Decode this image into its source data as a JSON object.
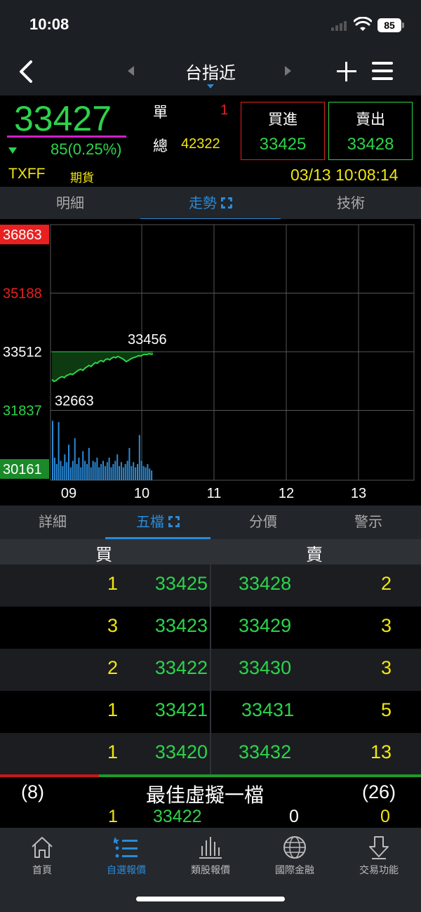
{
  "status": {
    "time": "10:08",
    "battery": "85"
  },
  "nav": {
    "title": "台指近"
  },
  "quote": {
    "price": "33427",
    "change": "85(0.25%)",
    "single_label": "單",
    "single_value": "1",
    "total_label": "總",
    "total_value": "42322",
    "buy_label": "買進",
    "buy_price": "33425",
    "sell_label": "賣出",
    "sell_price": "33428",
    "symbol": "TXFF",
    "type": "期貨",
    "datetime": "03/13 10:08:14"
  },
  "top_tabs": [
    {
      "label": "明細"
    },
    {
      "label": "走勢"
    },
    {
      "label": "技術"
    }
  ],
  "chart_data": {
    "type": "line",
    "y_labels": [
      "36863",
      "35188",
      "33512",
      "31837",
      "30161"
    ],
    "y_label_colors": [
      "#ffffff",
      "#e82020",
      "#ffffff",
      "#2bd44a",
      "#ffffff"
    ],
    "reference": 33512,
    "ylim": [
      30161,
      36863
    ],
    "x_ticks": [
      "09",
      "10",
      "11",
      "12",
      "13"
    ],
    "high_label": "33456",
    "low_label": "32663",
    "price_series": [
      32720,
      32663,
      32690,
      32740,
      32780,
      32800,
      32770,
      32830,
      32850,
      32880,
      32860,
      32900,
      32950,
      32990,
      33010,
      32980,
      33040,
      33080,
      33120,
      33090,
      33150,
      33200,
      33180,
      33240,
      33260,
      33230,
      33290,
      33310,
      33280,
      33330,
      33360,
      33340,
      33380,
      33350,
      33320,
      33280,
      33230,
      33260,
      33300,
      33330,
      33350,
      33370,
      33400,
      33390,
      33420,
      33440,
      33430,
      33456,
      33440,
      33450
    ],
    "volume_series": [
      0.92,
      0.35,
      0.25,
      0.9,
      0.3,
      0.22,
      0.4,
      0.28,
      0.55,
      0.2,
      0.3,
      0.65,
      0.25,
      0.35,
      0.2,
      0.45,
      0.3,
      0.25,
      0.5,
      0.2,
      0.3,
      0.28,
      0.35,
      0.2,
      0.25,
      0.3,
      0.22,
      0.28,
      0.35,
      0.2,
      0.25,
      0.3,
      0.4,
      0.22,
      0.28,
      0.2,
      0.25,
      0.3,
      0.5,
      0.22,
      0.28,
      0.2,
      0.25,
      0.7,
      0.3,
      0.22,
      0.2,
      0.25,
      0.18,
      0.15
    ]
  },
  "mid_tabs": [
    {
      "label": "詳細"
    },
    {
      "label": "五檔"
    },
    {
      "label": "分價"
    },
    {
      "label": "警示"
    }
  ],
  "book": {
    "buy_header": "買",
    "sell_header": "賣",
    "rows": [
      {
        "bid_qty": "1",
        "bid": "33425",
        "ask": "33428",
        "ask_qty": "2"
      },
      {
        "bid_qty": "3",
        "bid": "33423",
        "ask": "33429",
        "ask_qty": "3"
      },
      {
        "bid_qty": "2",
        "bid": "33422",
        "ask": "33430",
        "ask_qty": "3"
      },
      {
        "bid_qty": "1",
        "bid": "33421",
        "ask": "33431",
        "ask_qty": "5"
      },
      {
        "bid_qty": "1",
        "bid": "33420",
        "ask": "33432",
        "ask_qty": "13"
      }
    ],
    "buy_total": "(8)",
    "sell_total": "(26)",
    "buy_ratio": 0.235
  },
  "best": {
    "title": "最佳虛擬一檔",
    "bid_qty": "1",
    "bid": "33422",
    "ask": "0",
    "ask_qty": "0"
  },
  "tabbar": [
    {
      "label": "首頁",
      "icon": "home-icon"
    },
    {
      "label": "自選報價",
      "icon": "watchlist-icon"
    },
    {
      "label": "類股報價",
      "icon": "sector-chart-icon"
    },
    {
      "label": "國際金融",
      "icon": "globe-icon"
    },
    {
      "label": "交易功能",
      "icon": "trade-icon"
    }
  ],
  "colors": {
    "up": "#e82020",
    "down": "#2bd44a",
    "accent": "#2a8ad8",
    "highlight": "#f2e60e"
  }
}
